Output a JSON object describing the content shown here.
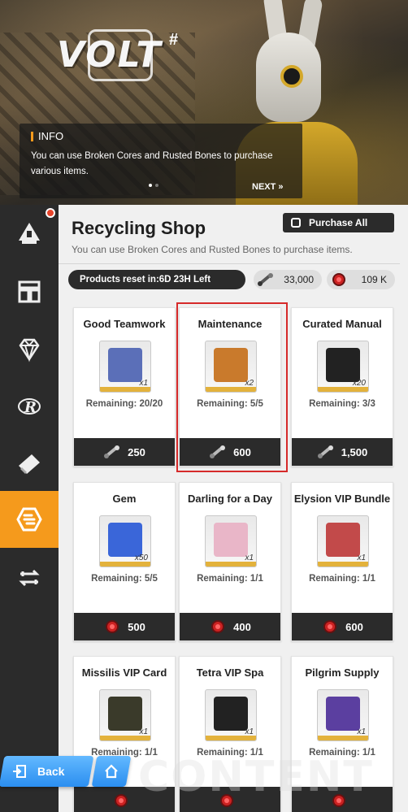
{
  "banner": {
    "logo_text": "VOLT",
    "logo_sup": "#",
    "info_title": "INFO",
    "info_text": "You can use Broken Cores and Rusted Bones to purchase various items.",
    "next_label": "NEXT »"
  },
  "sidebar": {
    "items": [
      {
        "icon": "tower-icon"
      },
      {
        "icon": "shop-layout-icon"
      },
      {
        "icon": "diamond-icon"
      },
      {
        "icon": "r-emblem-icon"
      },
      {
        "icon": "ticket-icon"
      },
      {
        "icon": "recycling-icon",
        "active": true
      },
      {
        "icon": "exchange-arrows-icon"
      }
    ],
    "notification_color": "#e8442b",
    "active_color": "#f59a1c"
  },
  "shop": {
    "title": "Recycling Shop",
    "purchase_all_label": "Purchase All",
    "subtitle": "You can use Broken Cores and Rusted Bones to purchase items.",
    "reset_label": "Products reset in:",
    "reset_value": "6D 23H Left",
    "currency_bones": "33,000",
    "currency_cores": "109 K"
  },
  "items": [
    {
      "name": "Good Teamwork",
      "qty": "x1",
      "remaining": "Remaining: 20/20",
      "price": "250",
      "currency": "bone"
    },
    {
      "name": "Maintenance",
      "qty": "x2",
      "remaining": "Remaining: 5/5",
      "price": "600",
      "currency": "bone"
    },
    {
      "name": "Curated Manual",
      "qty": "x20",
      "remaining": "Remaining: 3/3",
      "price": "1,500",
      "currency": "bone"
    },
    {
      "name": "Gem",
      "qty": "x50",
      "remaining": "Remaining: 5/5",
      "price": "500",
      "currency": "core"
    },
    {
      "name": "Darling for a Day",
      "qty": "x1",
      "remaining": "Remaining: 1/1",
      "price": "400",
      "currency": "core"
    },
    {
      "name": "Elysion VIP Bundle",
      "qty": "x1",
      "remaining": "Remaining: 1/1",
      "price": "600",
      "currency": "core"
    },
    {
      "name": "Missilis VIP Card",
      "qty": "x1",
      "remaining": "Remaining: 1/1",
      "price": "",
      "currency": "core"
    },
    {
      "name": "Tetra VIP Spa",
      "qty": "x1",
      "remaining": "Remaining: 1/1",
      "price": "",
      "currency": "core"
    },
    {
      "name": "Pilgrim Supply",
      "qty": "x1",
      "remaining": "Remaining: 1/1",
      "price": "",
      "currency": "core"
    }
  ],
  "nav": {
    "back_label": "Back",
    "watermark": "CONTENT"
  },
  "colors": {
    "accent": "#f59a1c",
    "highlight_border": "#d62a2a",
    "button_blue": "#2b8ef0"
  }
}
